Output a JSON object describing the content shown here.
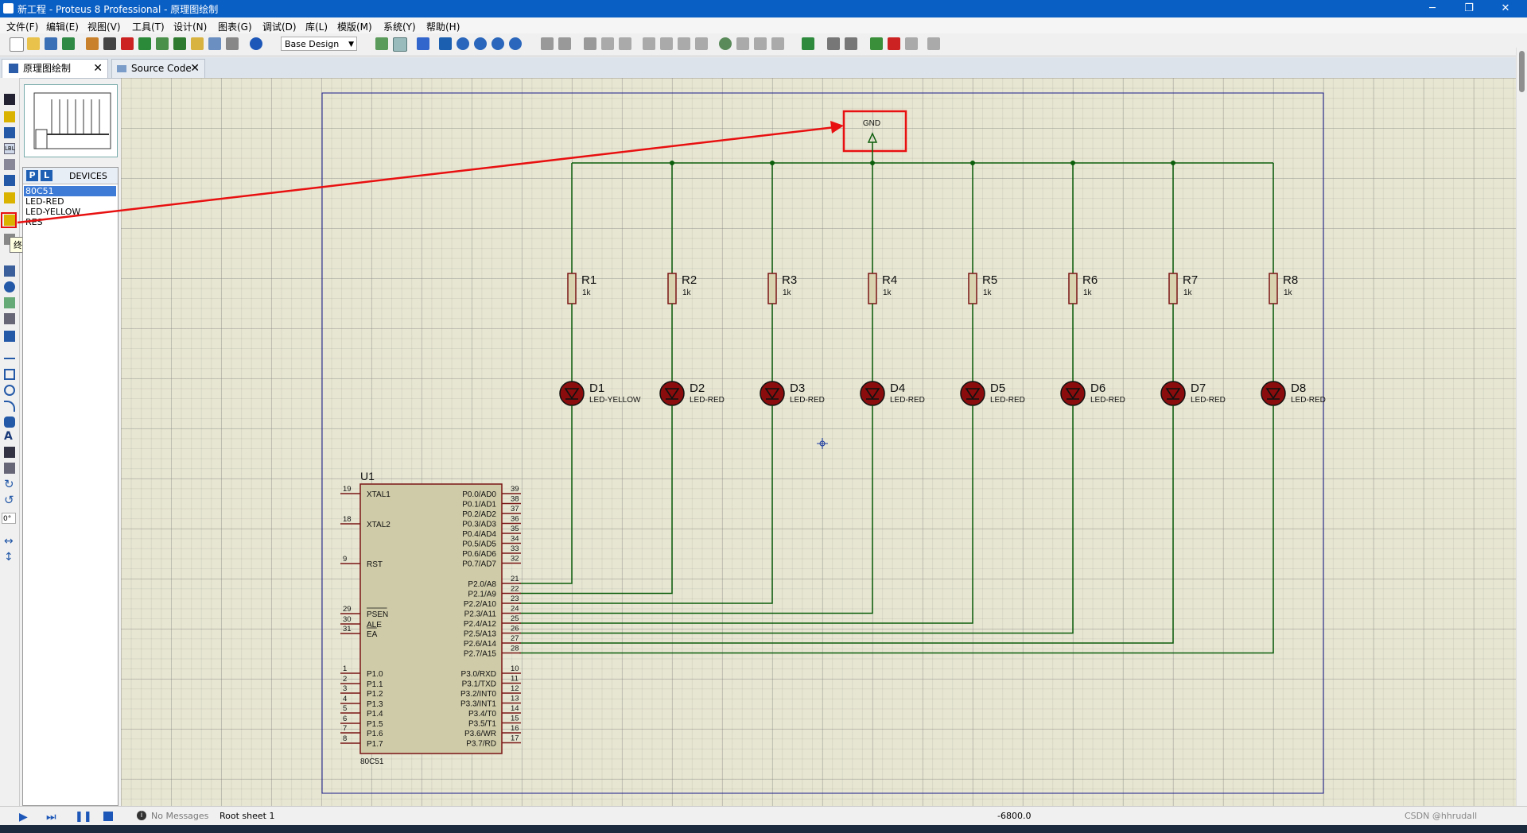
{
  "window": {
    "title": "新工程 - Proteus 8 Professional - 原理图绘制",
    "controls": [
      "─",
      "❐",
      "✕"
    ]
  },
  "menu": [
    "文件(F)",
    "编辑(E)",
    "视图(V)",
    "工具(T)",
    "设计(N)",
    "图表(G)",
    "调试(D)",
    "库(L)",
    "模版(M)",
    "系统(Y)",
    "帮助(H)"
  ],
  "toolbar": {
    "design_select": "Base Design"
  },
  "tabs": [
    {
      "label": "原理图绘制",
      "close": "✕",
      "active": true
    },
    {
      "label": "Source Code",
      "close": "✕",
      "active": false
    }
  ],
  "left_tools": {
    "rotation": "0°",
    "tooltip": "终端模式"
  },
  "devices": {
    "p_btn": "P",
    "l_btn": "L",
    "title": "DEVICES",
    "items": [
      "80C51",
      "LED-RED",
      "LED-YELLOW",
      "RES"
    ],
    "selected": "80C51"
  },
  "schematic": {
    "gnd_label": "GND",
    "chip": {
      "ref": "U1",
      "part": "80C51",
      "left_pins": [
        {
          "num": "19",
          "name": "XTAL1"
        },
        {
          "num": "18",
          "name": "XTAL2"
        },
        {
          "num": "9",
          "name": "RST"
        },
        {
          "num": "29",
          "name": "PSEN"
        },
        {
          "num": "30",
          "name": "ALE"
        },
        {
          "num": "31",
          "name": "EA"
        },
        {
          "num": "1",
          "name": "P1.0"
        },
        {
          "num": "2",
          "name": "P1.1"
        },
        {
          "num": "3",
          "name": "P1.2"
        },
        {
          "num": "4",
          "name": "P1.3"
        },
        {
          "num": "5",
          "name": "P1.4"
        },
        {
          "num": "6",
          "name": "P1.5"
        },
        {
          "num": "7",
          "name": "P1.6"
        },
        {
          "num": "8",
          "name": "P1.7"
        }
      ],
      "right_pins": [
        {
          "num": "39",
          "name": "P0.0/AD0"
        },
        {
          "num": "38",
          "name": "P0.1/AD1"
        },
        {
          "num": "37",
          "name": "P0.2/AD2"
        },
        {
          "num": "36",
          "name": "P0.3/AD3"
        },
        {
          "num": "35",
          "name": "P0.4/AD4"
        },
        {
          "num": "34",
          "name": "P0.5/AD5"
        },
        {
          "num": "33",
          "name": "P0.6/AD6"
        },
        {
          "num": "32",
          "name": "P0.7/AD7"
        },
        {
          "num": "21",
          "name": "P2.0/A8"
        },
        {
          "num": "22",
          "name": "P2.1/A9"
        },
        {
          "num": "23",
          "name": "P2.2/A10"
        },
        {
          "num": "24",
          "name": "P2.3/A11"
        },
        {
          "num": "25",
          "name": "P2.4/A12"
        },
        {
          "num": "26",
          "name": "P2.5/A13"
        },
        {
          "num": "27",
          "name": "P2.6/A14"
        },
        {
          "num": "28",
          "name": "P2.7/A15"
        },
        {
          "num": "10",
          "name": "P3.0/RXD"
        },
        {
          "num": "11",
          "name": "P3.1/TXD"
        },
        {
          "num": "12",
          "name": "P3.2/INT0"
        },
        {
          "num": "13",
          "name": "P3.3/INT1"
        },
        {
          "num": "14",
          "name": "P3.4/T0"
        },
        {
          "num": "15",
          "name": "P3.5/T1"
        },
        {
          "num": "16",
          "name": "P3.6/WR"
        },
        {
          "num": "17",
          "name": "P3.7/RD"
        }
      ]
    },
    "resistors": [
      {
        "ref": "R1",
        "value": "1k"
      },
      {
        "ref": "R2",
        "value": "1k"
      },
      {
        "ref": "R3",
        "value": "1k"
      },
      {
        "ref": "R4",
        "value": "1k"
      },
      {
        "ref": "R5",
        "value": "1k"
      },
      {
        "ref": "R6",
        "value": "1k"
      },
      {
        "ref": "R7",
        "value": "1k"
      },
      {
        "ref": "R8",
        "value": "1k"
      }
    ],
    "leds": [
      {
        "ref": "D1",
        "type": "LED-YELLOW"
      },
      {
        "ref": "D2",
        "type": "LED-RED"
      },
      {
        "ref": "D3",
        "type": "LED-RED"
      },
      {
        "ref": "D4",
        "type": "LED-RED"
      },
      {
        "ref": "D5",
        "type": "LED-RED"
      },
      {
        "ref": "D6",
        "type": "LED-RED"
      },
      {
        "ref": "D7",
        "type": "LED-RED"
      },
      {
        "ref": "D8",
        "type": "LED-RED"
      }
    ]
  },
  "status": {
    "messages": "No Messages",
    "sheet": "Root sheet 1",
    "coord": "-6800.0",
    "watermark": "CSDN @hhrudall"
  },
  "colors": {
    "wire": "#0b5d0b",
    "part": "#7a1515",
    "annotation": "#e81010",
    "title_bar": "#0a5fc4"
  }
}
